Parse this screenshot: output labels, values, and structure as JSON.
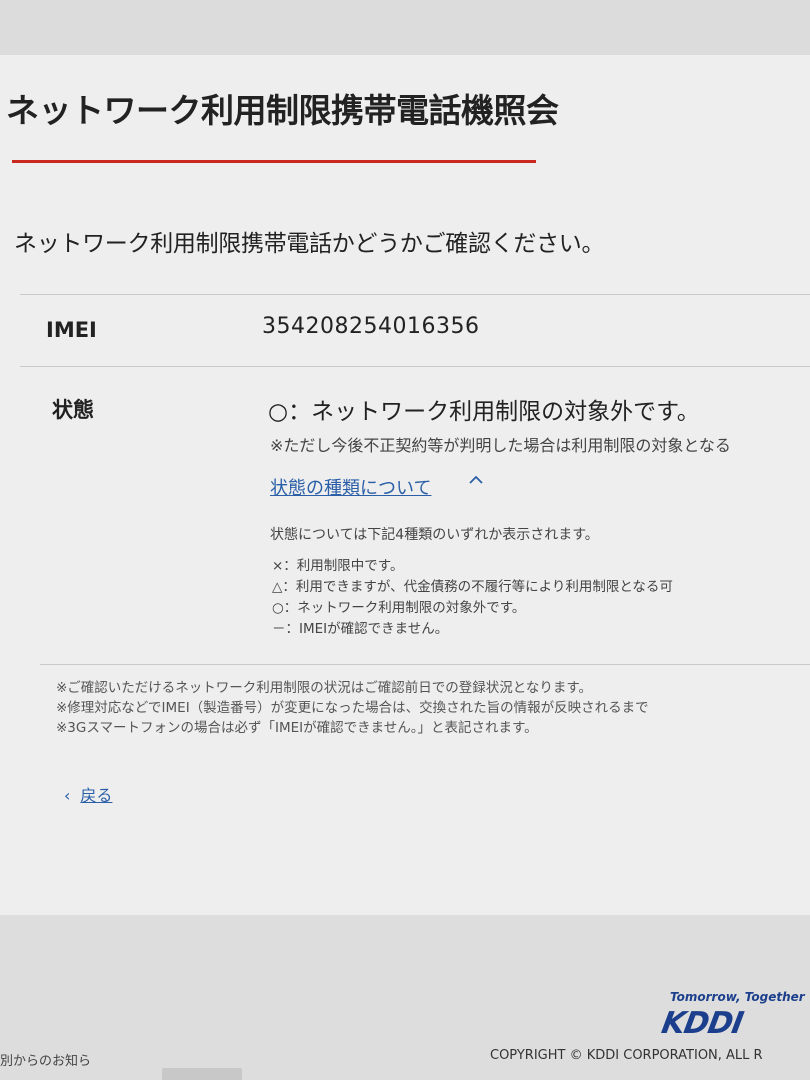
{
  "page": {
    "title": "ネットワーク利用制限携帯電話機照会",
    "lead": "ネットワーク利用制限携帯電話かどうかご確認ください。"
  },
  "result": {
    "imei_label": "IMEI",
    "imei_value": "354208254016356",
    "status_label": "状態",
    "status_main": "○：ネットワーク利用制限の対象外です。",
    "status_note": "※ただし今後不正契約等が判明した場合は利用制限の対象となる"
  },
  "status_types": {
    "link_label": "状態の種類について",
    "description": "状態については下記4種類のいずれか表示されます。",
    "items": [
      "×：利用制限中です。",
      "△：利用できますが、代金債務の不履行等により利用制限となる可",
      "○：ネットワーク利用制限の対象外です。",
      "－：IMEIが確認できません。"
    ]
  },
  "notes": [
    "※ご確認いただけるネットワーク利用制限の状況はご確認前日での登録状況となります。",
    "※修理対応などでIMEI（製造番号）が変更になった場合は、交換された旨の情報が反映されるまで",
    "※3Gスマートフォンの場合は必ず「IMEIが確認できません。」と表記されます。"
  ],
  "back": {
    "label": "戻る"
  },
  "footer": {
    "tagline": "Tomorrow, Together",
    "logo": "KDDI",
    "copyright": "COPYRIGHT © KDDI CORPORATION, ALL R",
    "bottom_left": "別からのお知ら"
  },
  "colors": {
    "accent_rule": "#c8281e",
    "link": "#2a5fa8",
    "brand": "#1b3f8c"
  }
}
